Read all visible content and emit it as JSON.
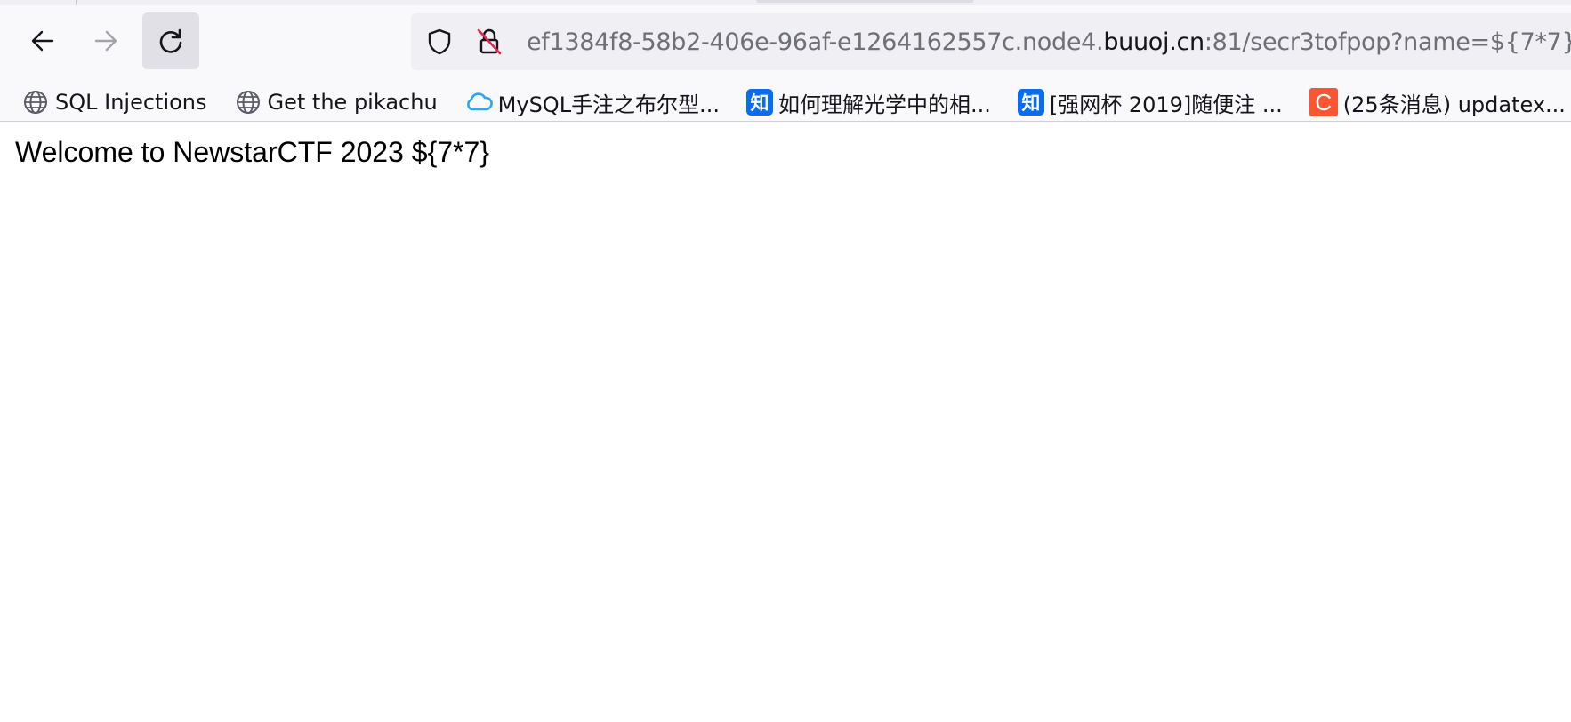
{
  "toolbar": {
    "back_icon": "arrow-left-icon",
    "forward_icon": "arrow-right-icon",
    "reload_icon": "reload-icon"
  },
  "urlbar": {
    "url_prefix": "ef1384f8-58b2-406e-96af-e1264162557c.node4.",
    "url_host": "buuoj.cn",
    "url_suffix": ":81/secr3tofpop?name=${7*7}",
    "shield_icon": "shield-icon",
    "lock_icon": "insecure-lock-icon"
  },
  "bookmarks": [
    {
      "label": "SQL Injections",
      "icon": "globe-icon"
    },
    {
      "label": "Get the pikachu",
      "icon": "globe-icon"
    },
    {
      "label": "MySQL手注之布尔型...",
      "icon": "cloud-icon"
    },
    {
      "label": "如何理解光学中的相...",
      "icon": "zhihu-icon",
      "icon_text": "知"
    },
    {
      "label": "[强网杯 2019]随便注 ...",
      "icon": "zhihu-icon",
      "icon_text": "知"
    },
    {
      "label": "(25条消息) updatex...",
      "icon": "csdn-icon",
      "icon_text": "C"
    }
  ],
  "page": {
    "heading": "Welcome to NewstarCTF 2023 ${7*7}"
  },
  "colors": {
    "toolbar_bg": "#f9f9fb",
    "urlbar_bg": "#f0f0f4",
    "zhihu_blue": "#0a6cf1",
    "csdn_orange": "#fc5531",
    "cloud_blue": "#2ba7f5"
  }
}
